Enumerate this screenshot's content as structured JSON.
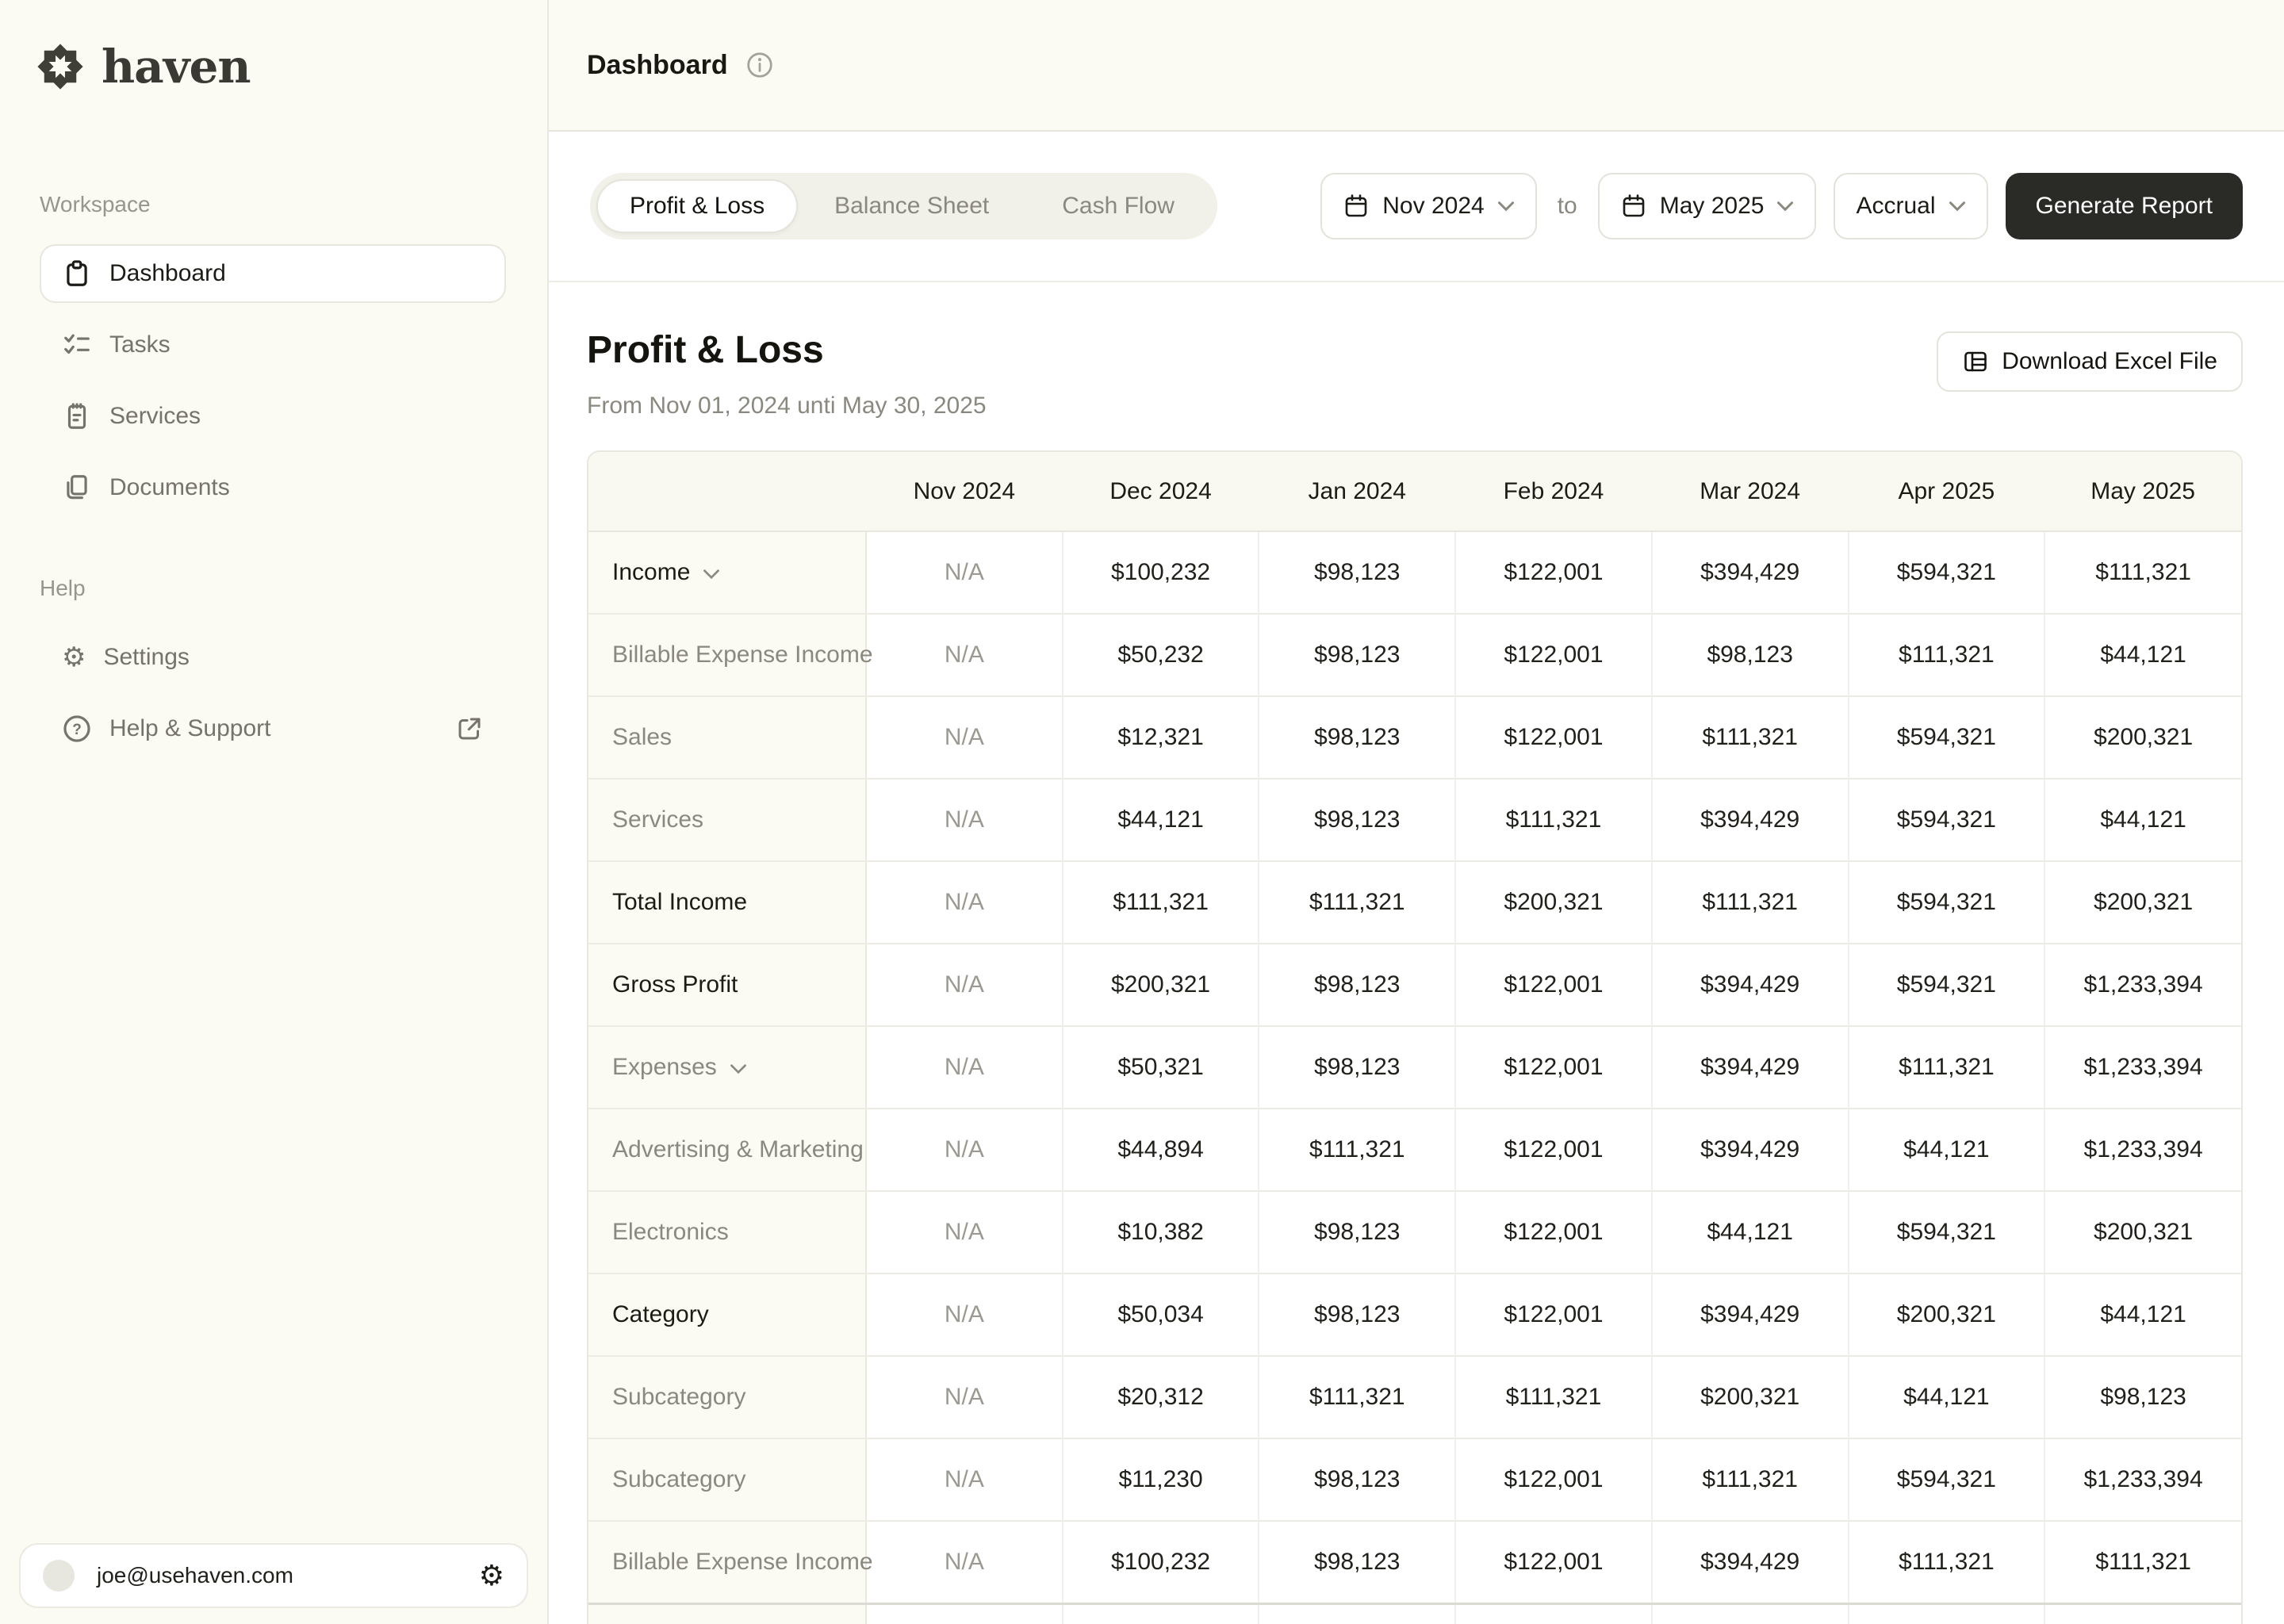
{
  "brand": {
    "name": "haven",
    "logo_icon": "star-flower-icon"
  },
  "colors": {
    "sidebar_bg": "#FBFAF3",
    "surface": "#FFFFFF",
    "border": "#E9E8E0",
    "text": "#1C1B16",
    "muted_text": "#8A887F",
    "dark_button": "#2A2A27",
    "table_header_bg": "#FAF9F1"
  },
  "sidebar": {
    "workspace_label": "Workspace",
    "help_label": "Help",
    "items": [
      {
        "label": "Dashboard",
        "icon": "clipboard-icon",
        "active": true
      },
      {
        "label": "Tasks",
        "icon": "checklist-icon",
        "active": false
      },
      {
        "label": "Services",
        "icon": "notepad-icon",
        "active": false
      },
      {
        "label": "Documents",
        "icon": "documents-icon",
        "active": false
      }
    ],
    "help_items": [
      {
        "label": "Settings",
        "icon": "gear-icon"
      },
      {
        "label": "Help & Support",
        "icon": "help-circle-icon",
        "trailing_icon": "external-link-icon"
      }
    ],
    "user": {
      "email": "joe@usehaven.com",
      "icon": "gear-icon"
    }
  },
  "header": {
    "title": "Dashboard",
    "info_icon": "info-circle-icon"
  },
  "toolbar": {
    "tabs": [
      "Profit & Loss",
      "Balance Sheet",
      "Cash Flow"
    ],
    "active_tab": "Profit & Loss",
    "date_from": "Nov 2024",
    "to_label": "to",
    "date_to": "May 2025",
    "basis": "Accrual",
    "generate_label": "Generate Report",
    "calendar_icon": "calendar-icon",
    "chevron_icon": "chevron-down-icon"
  },
  "report": {
    "title": "Profit & Loss",
    "subtitle": "From Nov 01, 2024 unti May 30, 2025",
    "download_label": "Download Excel File",
    "download_icon": "spreadsheet-icon"
  },
  "table": {
    "columns": [
      "Nov 2024",
      "Dec 2024",
      "Jan 2024",
      "Feb 2024",
      "Mar 2024",
      "Apr 2025",
      "May 2025"
    ],
    "rows": [
      {
        "label": "Income",
        "muted": false,
        "chevron": true,
        "values": [
          "N/A",
          "$100,232",
          "$98,123",
          "$122,001",
          "$394,429",
          "$594,321",
          "$111,321"
        ]
      },
      {
        "label": "Billable Expense Income",
        "muted": true,
        "chevron": false,
        "values": [
          "N/A",
          "$50,232",
          "$98,123",
          "$122,001",
          "$98,123",
          "$111,321",
          "$44,121"
        ]
      },
      {
        "label": "Sales",
        "muted": true,
        "chevron": false,
        "values": [
          "N/A",
          "$12,321",
          "$98,123",
          "$122,001",
          "$111,321",
          "$594,321",
          "$200,321"
        ]
      },
      {
        "label": "Services",
        "muted": true,
        "chevron": false,
        "values": [
          "N/A",
          "$44,121",
          "$98,123",
          "$111,321",
          "$394,429",
          "$594,321",
          "$44,121"
        ]
      },
      {
        "label": "Total Income",
        "muted": false,
        "chevron": false,
        "values": [
          "N/A",
          "$111,321",
          "$111,321",
          "$200,321",
          "$111,321",
          "$594,321",
          "$200,321"
        ]
      },
      {
        "label": "Gross Profit",
        "muted": false,
        "chevron": false,
        "values": [
          "N/A",
          "$200,321",
          "$98,123",
          "$122,001",
          "$394,429",
          "$594,321",
          "$1,233,394"
        ]
      },
      {
        "label": "Expenses",
        "muted": true,
        "chevron": true,
        "values": [
          "N/A",
          "$50,321",
          "$98,123",
          "$122,001",
          "$394,429",
          "$111,321",
          "$1,233,394"
        ]
      },
      {
        "label": "Advertising & Marketing",
        "muted": true,
        "chevron": false,
        "values": [
          "N/A",
          "$44,894",
          "$111,321",
          "$122,001",
          "$394,429",
          "$44,121",
          "$1,233,394"
        ]
      },
      {
        "label": "Electronics",
        "muted": true,
        "chevron": false,
        "values": [
          "N/A",
          "$10,382",
          "$98,123",
          "$122,001",
          "$44,121",
          "$594,321",
          "$200,321"
        ]
      },
      {
        "label": "Category",
        "muted": false,
        "chevron": false,
        "values": [
          "N/A",
          "$50,034",
          "$98,123",
          "$122,001",
          "$394,429",
          "$200,321",
          "$44,121"
        ]
      },
      {
        "label": "Subcategory",
        "muted": true,
        "chevron": false,
        "values": [
          "N/A",
          "$20,312",
          "$111,321",
          "$111,321",
          "$200,321",
          "$44,121",
          "$98,123"
        ]
      },
      {
        "label": "Subcategory",
        "muted": true,
        "chevron": false,
        "values": [
          "N/A",
          "$11,230",
          "$98,123",
          "$122,001",
          "$111,321",
          "$594,321",
          "$1,233,394"
        ]
      },
      {
        "label": "Billable Expense Income",
        "muted": true,
        "chevron": false,
        "values": [
          "N/A",
          "$100,232",
          "$98,123",
          "$122,001",
          "$394,429",
          "$111,321",
          "$111,321"
        ]
      }
    ]
  }
}
